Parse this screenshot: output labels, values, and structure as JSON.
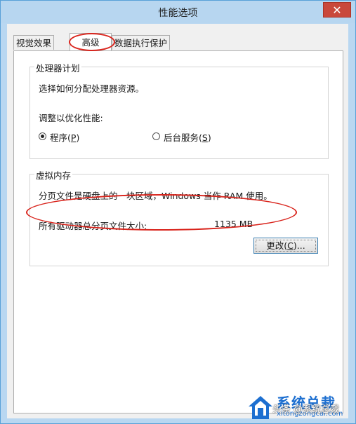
{
  "window": {
    "title": "性能选项",
    "close_glyph": "✕"
  },
  "tabs": [
    {
      "label": "视觉效果",
      "active": false
    },
    {
      "label": "高级",
      "active": true
    },
    {
      "label": "数据执行保护",
      "active": false
    }
  ],
  "processor": {
    "legend": "处理器计划",
    "description": "选择如何分配处理器资源。",
    "optimize_label": "调整以优化性能:",
    "options": [
      {
        "text": "程序(",
        "key": "P",
        "suffix": ")",
        "checked": true
      },
      {
        "text": "后台服务(",
        "key": "S",
        "suffix": ")",
        "checked": false
      }
    ]
  },
  "virtual_memory": {
    "legend": "虚拟内存",
    "description": "分页文件是硬盘上的一块区域，Windows 当作 RAM 使用。",
    "total_label": "所有驱动器总分页文件大小:",
    "total_value": "1135 MB",
    "change_button": {
      "text": "更改(",
      "key": "C",
      "suffix": ")..."
    }
  },
  "watermark": {
    "brand": "系统总裁",
    "url": "xitongzongcai.com",
    "overlay": "头条 @系统总裁",
    "icon": "house-logo-icon",
    "color": "#1d6fd0"
  },
  "annotations_color": "#d9241c"
}
